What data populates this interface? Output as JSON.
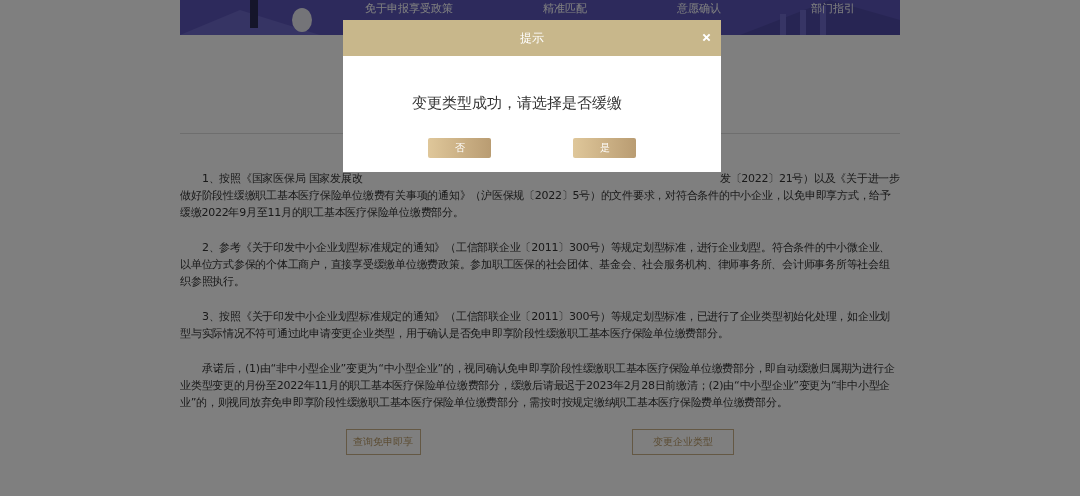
{
  "banner": {
    "items": [
      {
        "label": "免于申报享受政策"
      },
      {
        "label": "精准匹配"
      },
      {
        "label": "意愿确认"
      },
      {
        "label": "部门指引"
      }
    ]
  },
  "paragraph_1": {
    "line_start": "1、按照《国家医保局 国家发展改",
    "line_end": "发〔2022〕21号）以及《关于进一步",
    "continuation": "做好阶段性缓缴职工基本医疗保险单位缴费有关事项的通知》（沪医保规〔2022〕5号）的文件要求，对符合条件的中小企业，以免申即享方式，给予缓缴2022年9月至11月的职工基本医疗保险单位缴费部分。"
  },
  "paragraphs": [
    "2、参考《关于印发中小企业划型标准规定的通知》（工信部联企业〔2011〕300号）等规定划型标准，进行企业划型。符合条件的中小微企业、以单位方式参保的个体工商户，直接享受缓缴单位缴费政策。参加职工医保的社会团体、基金会、社会服务机构、律师事务所、会计师事务所等社会组织参照执行。",
    "3、按照《关于印发中小企业划型标准规定的通知》（工信部联企业〔2011〕300号）等规定划型标准，已进行了企业类型初始化处理，如企业划型与实际情况不符可通过此申请变更企业类型，用于确认是否免申即享阶段性缓缴职工基本医疗保险单位缴费部分。",
    "承诺后，(1)由“非中小型企业”变更为“中小型企业”的，视同确认免申即享阶段性缓缴职工基本医疗保险单位缴费部分，即自动缓缴归属期为进行企业类型变更的月份至2022年11月的职工基本医疗保险单位缴费部分，缓缴后请最迟于2023年2月28日前缴清；(2)由“中小型企业”变更为“非中小型企业”的，则视同放弃免申即享阶段性缓缴职工基本医疗保险单位缴费部分，需按时按规定缴纳职工基本医疗保险费单位缴费部分。"
  ],
  "buttons": [
    "查询免申即享",
    "变更企业类型"
  ],
  "dialog": {
    "title": "提示",
    "message": "变更类型成功，请选择是否缓缴",
    "buttons": [
      "否",
      "是"
    ]
  }
}
